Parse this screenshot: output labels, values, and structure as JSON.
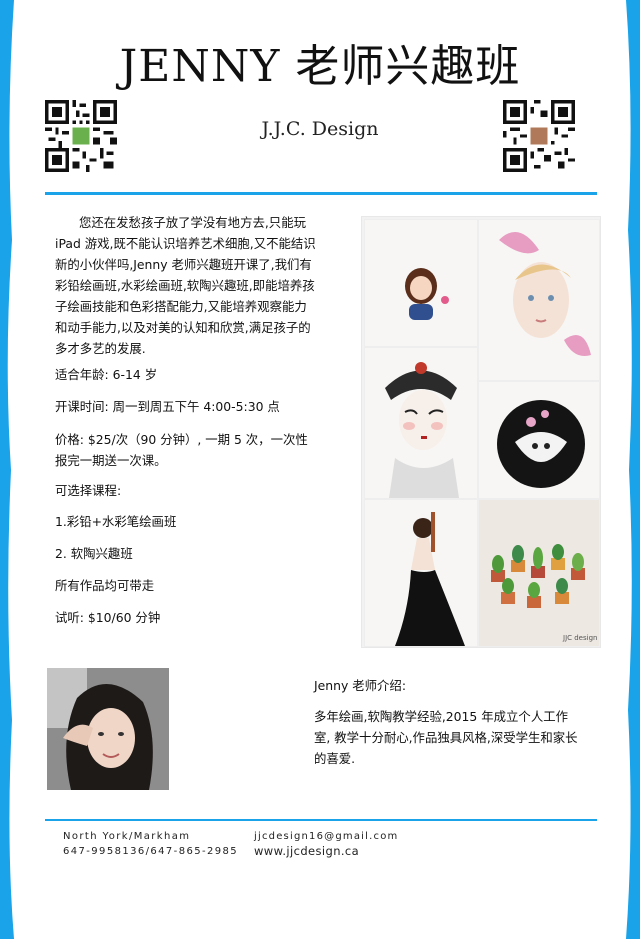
{
  "header": {
    "title": "JENNY 老师兴趣班",
    "subtitle": "J.J.C. Design"
  },
  "intro": {
    "text": "您还在发愁孩子放了学没有地方去,只能玩 iPad 游戏,既不能认识培养艺术细胞,又不能结识新的小伙伴吗,Jenny 老师兴趣班开课了,我们有彩铅绘画班,水彩绘画班,软陶兴趣班,即能培养孩子绘画技能和色彩搭配能力,又能培养观察能力和动手能力,以及对美的认知和欣赏,满足孩子的多才多艺的发展."
  },
  "details": {
    "age": "适合年龄: 6-14 岁",
    "time": "开课时间: 周一到周五下午 4:00-5:30 点",
    "price": "价格: $25/次（90 分钟）, 一期 5 次，一次性报完一期送一次课。",
    "courses_label": "可选择课程:",
    "course_1": "1.彩铅+水彩笔绘画班",
    "course_2": "2. 软陶兴趣班",
    "takeaway": "所有作品均可带走",
    "trial": "试听: $10/60 分钟"
  },
  "collage": {
    "signature": "JJC design"
  },
  "bio": {
    "title": "Jenny 老师介绍:",
    "text": "多年绘画,软陶教学经验,2015 年成立个人工作室, 教学十分耐心,作品独具风格,深受学生和家长的喜爱."
  },
  "footer": {
    "location": "North York/Markham",
    "phones": "647-9958136/647-865-2985",
    "email": "jjcdesign16@gmail.com",
    "website": "www.jjcdesign.ca"
  },
  "colors": {
    "accent": "#1aa3e8"
  }
}
